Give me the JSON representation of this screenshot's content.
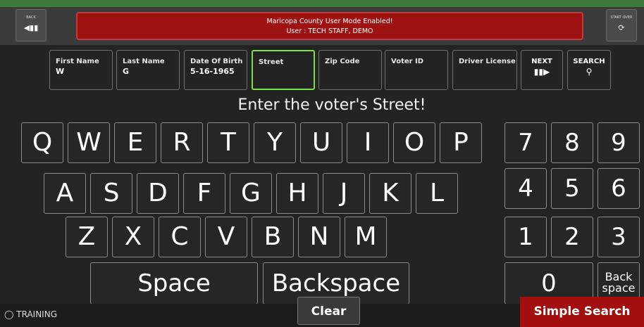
{
  "header": {
    "back_label": "BACK",
    "start_over_label": "START OVER",
    "alert_line1": "Maricopa County User Mode Enabled!",
    "alert_line2": "User : TECH STAFF, DEMO"
  },
  "fields": [
    {
      "label": "First Name",
      "value": "W"
    },
    {
      "label": "Last Name",
      "value": "G"
    },
    {
      "label": "Date Of Birth",
      "value": "5-16-1965"
    },
    {
      "label": "Street",
      "value": ""
    },
    {
      "label": "Zip Code",
      "value": ""
    },
    {
      "label": "Voter ID",
      "value": ""
    },
    {
      "label": "Driver License",
      "value": ""
    }
  ],
  "actions": {
    "next": "NEXT",
    "search": "SEARCH"
  },
  "prompt": "Enter the voter's Street!",
  "keyboard": {
    "row1": [
      "Q",
      "W",
      "E",
      "R",
      "T",
      "Y",
      "U",
      "I",
      "O",
      "P"
    ],
    "row2": [
      "A",
      "S",
      "D",
      "F",
      "G",
      "H",
      "J",
      "K",
      "L"
    ],
    "row3": [
      "Z",
      "X",
      "C",
      "V",
      "B",
      "N",
      "M"
    ],
    "space": "Space",
    "backspace": "Backspace"
  },
  "numpad": {
    "row1": [
      "7",
      "8",
      "9"
    ],
    "row2": [
      "4",
      "5",
      "6"
    ],
    "row3": [
      "1",
      "2",
      "3"
    ],
    "zero": "0",
    "back_line1": "Back",
    "back_line2": "space"
  },
  "footer": {
    "training": "TRAINING",
    "clear": "Clear",
    "simple_search": "Simple Search"
  },
  "colors": {
    "alert": "#9e1212",
    "active_field": "#7be04a",
    "simple_search": "#a30f0f"
  }
}
